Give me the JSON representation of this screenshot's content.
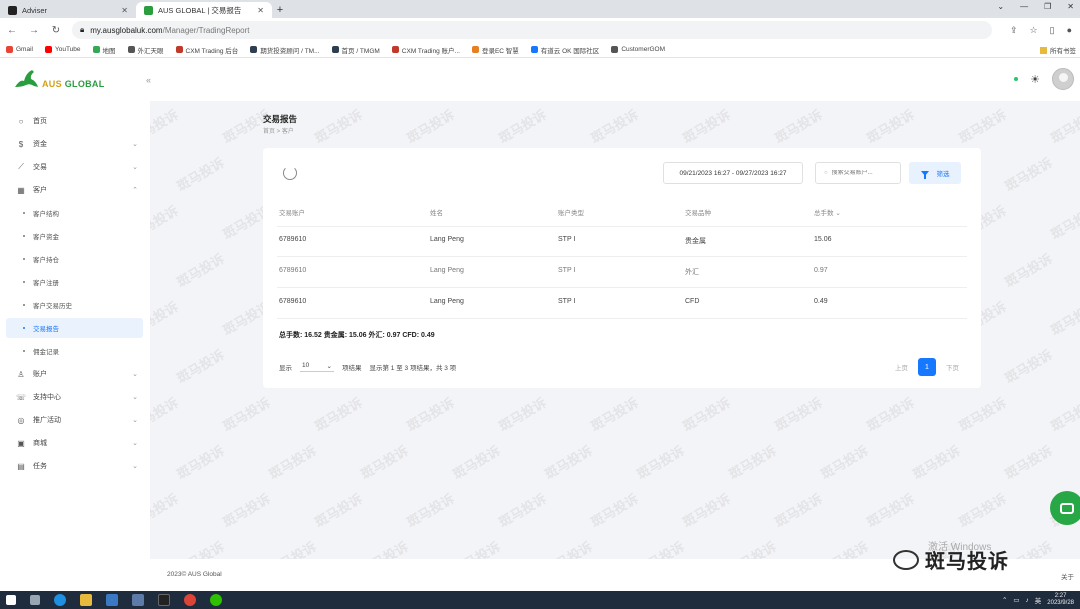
{
  "browser": {
    "tabs": [
      {
        "label": "Adviser",
        "active": false
      },
      {
        "label": "AUS GLOBAL | 交易报告",
        "active": true
      }
    ],
    "url_host": "my.ausglobaluk.com",
    "url_path": "/Manager/TradingReport",
    "bookmarks": [
      "Gmail",
      "YouTube",
      "地图",
      "外汇天眼",
      "CXM Trading 后台",
      "期货投资顾问 / TM...",
      "首页 / TMGM",
      "CXM Trading 账户...",
      "登录EC 智慧",
      "有道云 OK 国际社区",
      "CustomerGOM"
    ],
    "bookmarks_right": "所有书签"
  },
  "app": {
    "brand_main": "AUS",
    "brand_sub": "GLOBAL",
    "collapse_label": "«"
  },
  "sidebar": {
    "items": [
      {
        "label": "首页",
        "icon": "home-icon",
        "glyph": "○",
        "expandable": false
      },
      {
        "label": "资金",
        "icon": "dollar-icon",
        "glyph": "$",
        "expandable": true
      },
      {
        "label": "交易",
        "icon": "chart-icon",
        "glyph": "⟋",
        "expandable": true
      },
      {
        "label": "客户",
        "icon": "grid-icon",
        "glyph": "▦",
        "expandable": true,
        "expanded": true
      }
    ],
    "sub_items": [
      {
        "label": "客户结构",
        "active": false
      },
      {
        "label": "客户资金",
        "active": false
      },
      {
        "label": "客户持仓",
        "active": false
      },
      {
        "label": "客户注册",
        "active": false
      },
      {
        "label": "客户交易历史",
        "active": false
      },
      {
        "label": "交易报告",
        "active": true
      },
      {
        "label": "佣金记录",
        "active": false
      }
    ],
    "items_after": [
      {
        "label": "账户",
        "icon": "user-icon",
        "glyph": "♙",
        "expandable": true
      },
      {
        "label": "支持中心",
        "icon": "support-icon",
        "glyph": "☏",
        "expandable": true
      },
      {
        "label": "推广活动",
        "icon": "promo-icon",
        "glyph": "◎",
        "expandable": true
      },
      {
        "label": "商城",
        "icon": "shop-icon",
        "glyph": "▣",
        "expandable": true
      },
      {
        "label": "任务",
        "icon": "gift-icon",
        "glyph": "▤",
        "expandable": true
      }
    ]
  },
  "page": {
    "title": "交易报告",
    "breadcrumb": "首页 > 客户"
  },
  "filters": {
    "date_range": "09/21/2023 16:27 - 09/27/2023 16:27",
    "search_placeholder": "搜索交易账户...",
    "filter_label": "筛选"
  },
  "table": {
    "headers": [
      "交易账户",
      "姓名",
      "账户类型",
      "交易品种",
      "总手数"
    ],
    "rows": [
      [
        "6789610",
        "Lang Peng",
        "STP",
        "贵金属",
        "15.06"
      ],
      [
        "6789610",
        "Lang Peng",
        "STP",
        "外汇",
        "0.97"
      ],
      [
        "6789610",
        "Lang Peng",
        "STP",
        "CFD",
        "0.49"
      ]
    ],
    "summary": "总手数: 16.52  贵金属: 15.06  外汇: 0.97  CFD: 0.49"
  },
  "pagination": {
    "show_label": "显示",
    "page_size": "10",
    "per_page_label": "项结果",
    "range_label": "显示第 1 至 3 项结果，共 3 项",
    "prev_label": "上页",
    "current_page": "1",
    "next_label": "下页"
  },
  "footer": {
    "copyright": "2023© AUS Global",
    "about": "关于"
  },
  "overlay": {
    "activate_windows": "激活 Windows",
    "watermark_brand": "斑马投诉",
    "watermark_tile": "斑马投诉"
  },
  "taskbar": {
    "tray_text": "英",
    "time": "2:27",
    "date": "2023/9/28"
  },
  "colors": {
    "accent": "#1677ff",
    "brand_green": "#2a9d3f",
    "brand_gold": "#d4a017"
  }
}
